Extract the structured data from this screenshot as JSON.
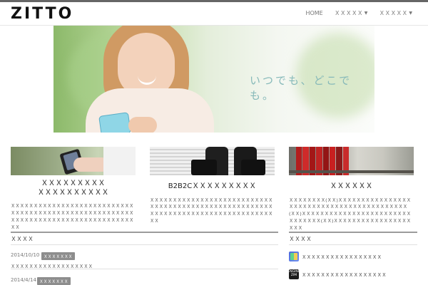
{
  "header": {
    "logo": "ZITTO",
    "nav": [
      {
        "label": "HOME"
      },
      {
        "label": "ＸＸＸＸＸ"
      },
      {
        "label": "ＸＸＸＸＸ"
      }
    ]
  },
  "hero": {
    "caption": "いつでも、どこでも。"
  },
  "features": [
    {
      "title": "ＸＸＸＸＸＸＸＸＸ\nＸＸＸＸＸＸＸＸＸＸ",
      "body": "ＸＸＸＸＸＸＸＸＸＸＸＸＸＸＸＸＸＸＸＸＸＸＸＸＸＸＸＸＸＸＸＸＸＸＸＸＸＸＸＸＸＸＸＸＸＸＸＸＸＸＸＸＸＸＸＸＸＸＸＸＸＸＸＸＸＸＸＸＸＸＸＸＸＸＸＸＸＸＸＸＸＸＸ"
    },
    {
      "title": "B2B2CＸＸＸＸＸＸＸＸＸ",
      "body": "ＸＸＸＸＸＸＸＸＸＸＸＸＸＸＸＸＸＸＸＸＸＸＸＸＸＸＸＸＸＸＸＸＸＸＸＸＸＸＸＸＸＸＸＸＸＸＸＸＸＸＸＸＸＸＸＸＸＸＸＸＸＸＸＸＸＸＸＸＸＸＸＸＸＸＸＸＸＸＸＸＸＸＸ"
    },
    {
      "title": "ＸＸＸＸＸＸ",
      "body": "ＸＸＸＸＸＸＸＸ(ＸＸ)ＸＸＸＸＸＸＸＸＸＸＸＸＸＸＸＸＸＸＸＸＸＸＸＸＸＸＸＸＸＸＸＸＸＸＸＸＸＸＸＸＸＸ(ＸＸ)ＸＸＸＸＸＸＸＸＸＸＸＸＸＸＸＸＸＸＸＸＸＸＸＸＸＸＸＸＸＸＸ(ＸＸ)ＸＸＸＸＸＸＸＸＸＸＸＸＸＸＸＸＸＸＸＸ"
    }
  ],
  "news": {
    "title": "ＸＸＸＸ",
    "items": [
      {
        "date": "2014/10/10",
        "badge": "ＸＸＸＸＸＸＸ",
        "text": "ＸＸＸＸＸＸＸＸＸＸＸＸＸＸＸＸＸＸ"
      },
      {
        "date": "2014/4/14",
        "badge": "ＸＸＸＸＸＸＸ"
      }
    ]
  },
  "links": {
    "title": "ＸＸＸＸ",
    "items": [
      {
        "label": "ＸＸＸＸＸＸＸＸＸＸＸＸＸＸＸＸＸ"
      },
      {
        "label": "ＸＸＸＸＸＸＸＸＸＸＸＸＸＸＸＸＸＸ"
      }
    ],
    "second_icon_label": "ENGINE\nZIM"
  }
}
